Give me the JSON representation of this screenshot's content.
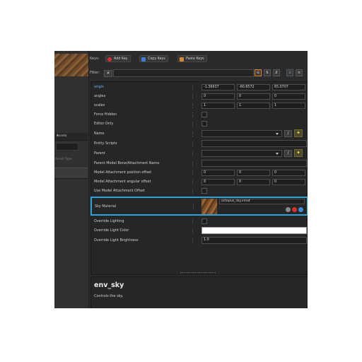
{
  "toolbar": {
    "keys_label": "Keys:",
    "add_key": "Add Key",
    "copy_keys": "Copy Keys",
    "paste_keys": "Paste Keys"
  },
  "left_panel": {
    "header": "Assets",
    "field_label": "Asset Type"
  },
  "filter": {
    "label": "Filter:",
    "value": ""
  },
  "properties": {
    "origin": {
      "label": "origin",
      "x": "-1.36937",
      "y": "-60.6572",
      "z": "65.0707"
    },
    "angles": {
      "label": "angles",
      "x": "0",
      "y": "0",
      "z": "0"
    },
    "scales": {
      "label": "scales",
      "x": "1",
      "y": "1",
      "z": "1"
    },
    "force_hidden": {
      "label": "Force Hidden"
    },
    "editor_only": {
      "label": "Editor Only"
    },
    "name": {
      "label": "Name"
    },
    "entity_scripts": {
      "label": "Entity Scripts"
    },
    "parent": {
      "label": "Parent"
    },
    "parent_bone": {
      "label": "Parent Model Bone/Attachment Name"
    },
    "attach_pos": {
      "label": "Model Attachment position offset",
      "x": "0",
      "y": "0",
      "z": "0"
    },
    "attach_ang": {
      "label": "Model Attachment angular offset",
      "x": "0",
      "y": "0",
      "z": "0"
    },
    "use_attach": {
      "label": "Use Model Attachment Offset"
    },
    "sky_material": {
      "label": "Sky Material",
      "value": "octopus_sky.vmat"
    },
    "override_lighting": {
      "label": "Override Lighting"
    },
    "override_light_color": {
      "label": "Override Light Color",
      "color": "#ffffff"
    },
    "override_light_brightness": {
      "label": "Override Light Brightness",
      "value": "1.0"
    }
  },
  "description": {
    "title": "env_sky",
    "text": "Controls the sky."
  },
  "colors": {
    "accent": "#2aa3d9",
    "add_key": "#d9302a",
    "copy_keys": "#3c7fd6",
    "paste_keys": "#d9872a"
  },
  "icons": [
    "picker-icon",
    "goto-icon",
    "clear-icon",
    "search-icon",
    "sort-icon"
  ]
}
